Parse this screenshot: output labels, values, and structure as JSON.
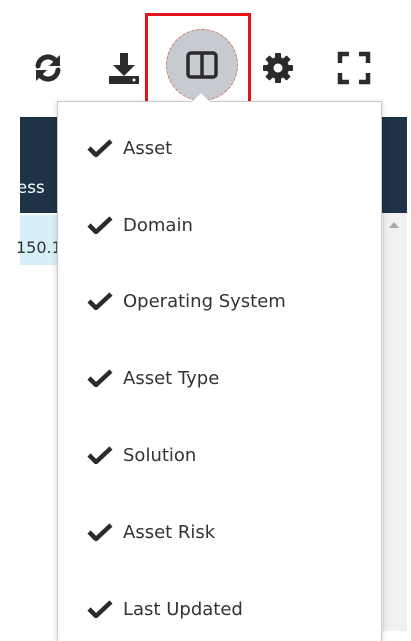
{
  "toolbar": {
    "buttons": [
      {
        "name": "refresh",
        "icon": "refresh-icon"
      },
      {
        "name": "download",
        "icon": "download-icon"
      },
      {
        "name": "columns",
        "icon": "columns-icon"
      },
      {
        "name": "settings",
        "icon": "gear-icon"
      },
      {
        "name": "fullscreen",
        "icon": "fullscreen-icon"
      }
    ],
    "highlight_color": "#e4141c"
  },
  "table": {
    "header_fragment": "ress",
    "row_fragment": "150.1",
    "header_bg": "#1e3346",
    "selected_row_bg": "#d7f0f8"
  },
  "column_menu": {
    "items": [
      {
        "label": "Asset",
        "checked": true
      },
      {
        "label": "Domain",
        "checked": true
      },
      {
        "label": "Operating System",
        "checked": true
      },
      {
        "label": "Asset Type",
        "checked": true
      },
      {
        "label": "Solution",
        "checked": true
      },
      {
        "label": "Asset Risk",
        "checked": true
      },
      {
        "label": "Last Updated",
        "checked": true
      }
    ]
  }
}
